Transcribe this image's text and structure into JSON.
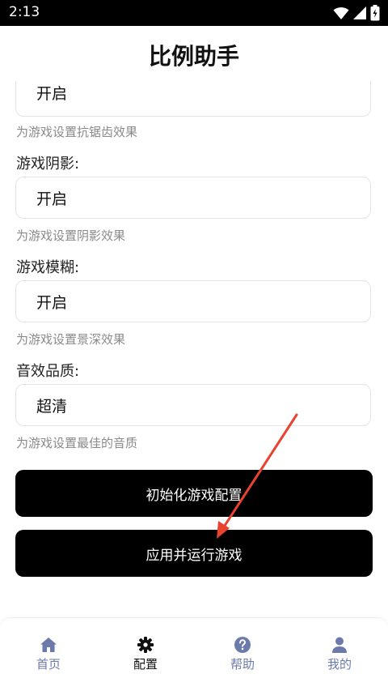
{
  "status_bar": {
    "time": "2:13"
  },
  "header": {
    "title": "比例助手"
  },
  "settings": {
    "antialias": {
      "value": "开启",
      "hint": "为游戏设置抗锯齿效果"
    },
    "shadow": {
      "label": "游戏阴影:",
      "value": "开启",
      "hint": "为游戏设置阴影效果"
    },
    "blur": {
      "label": "游戏模糊:",
      "value": "开启",
      "hint": "为游戏设置景深效果"
    },
    "audio": {
      "label": "音效品质:",
      "value": "超清",
      "hint": "为游戏设置最佳的音质"
    }
  },
  "actions": {
    "init_label": "初始化游戏配置",
    "apply_label": "应用并运行游戏"
  },
  "nav": {
    "items": [
      {
        "label": "首页",
        "icon": "home-icon",
        "active": false
      },
      {
        "label": "配置",
        "icon": "gear-icon",
        "active": true
      },
      {
        "label": "帮助",
        "icon": "help-icon",
        "active": false
      },
      {
        "label": "我的",
        "icon": "user-icon",
        "active": false
      }
    ]
  },
  "colors": {
    "accent": "#000000",
    "nav_inactive": "#6b7aaa",
    "annotation_arrow": "#e8432f"
  }
}
